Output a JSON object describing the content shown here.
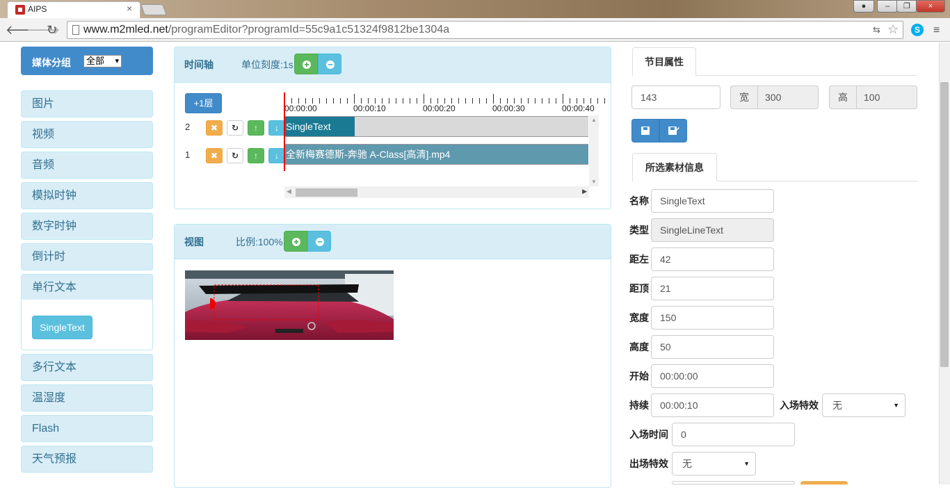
{
  "browser": {
    "tab_title": "AIPS",
    "url_host": "www.m2mled.net",
    "url_path": "/programEditor?programId=55c9a1c51324f9812be1304a",
    "window_buttons": [
      "minimize",
      "maximize",
      "close"
    ]
  },
  "media": {
    "title": "媒体分组",
    "group_select": "全部",
    "categories": [
      "图片",
      "视频",
      "音频",
      "模拟时钟",
      "数字时钟",
      "倒计时",
      "单行文本",
      "多行文本",
      "温湿度",
      "Flash",
      "天气预报"
    ],
    "expanded_category": "单行文本",
    "expanded_items": [
      "SingleText"
    ]
  },
  "timeline": {
    "title": "时间轴",
    "unit_label": "单位刻度:1s",
    "add_layer_label": "+1层",
    "ticks": [
      "00:00:00",
      "00:00:10",
      "00:00:20",
      "00:00:30",
      "00:00:40"
    ],
    "layers": [
      {
        "number": "2",
        "clip": "SingleText",
        "clip_color": "#1b7a93",
        "clip_fraction": 0.23
      },
      {
        "number": "1",
        "clip": "全新梅赛德斯-奔驰 A-Class[高清].mp4",
        "clip_color": "#5f99ad",
        "clip_fraction": 1.0
      }
    ]
  },
  "view": {
    "title": "视图",
    "scale_label": "比例:100%"
  },
  "program_props": {
    "tab": "节目属性",
    "id_value": "143",
    "width_label": "宽",
    "width_value": "300",
    "height_label": "高",
    "height_value": "100"
  },
  "material_info": {
    "tab": "所选素材信息",
    "name_label": "名称",
    "name_value": "SingleText",
    "type_label": "类型",
    "type_value": "SingleLineText",
    "left_label": "距左",
    "left_value": "42",
    "top_label": "距顶",
    "top_value": "21",
    "width_label": "宽度",
    "width_value": "150",
    "height_label": "高度",
    "height_value": "50",
    "start_label": "开始",
    "start_value": "00:00:00",
    "duration_label": "持续",
    "duration_value": "00:00:10",
    "enter_effect_label": "入场特效",
    "enter_effect_value": "无",
    "enter_time_label": "入场时间",
    "enter_time_value": "0",
    "exit_effect_label": "出场特效",
    "exit_effect_value": "无"
  },
  "colors": {
    "primary": "#428bca",
    "success": "#5cb85c",
    "info": "#5bc0de",
    "warning": "#f0ad4e",
    "panel_head": "#d9edf7",
    "playhead": "#ee0000"
  }
}
